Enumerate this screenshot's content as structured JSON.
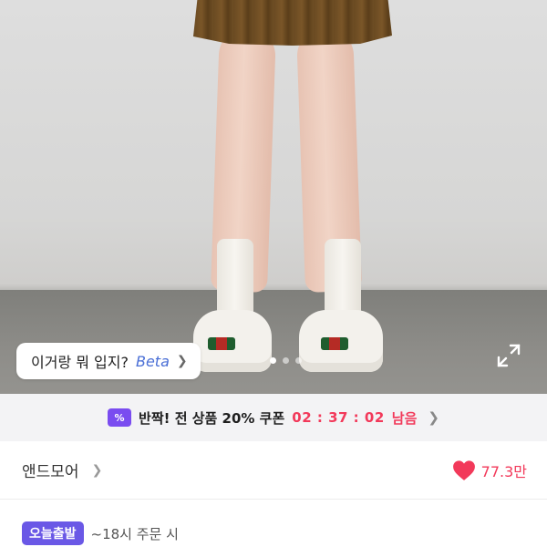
{
  "product_image": {
    "ai_chip": {
      "text": "이거랑 뭐 입지?",
      "beta": "Beta",
      "icon": "chevron-right-icon"
    },
    "carousel": {
      "count": 3,
      "active": 0
    },
    "expand_icon": "expand-icon"
  },
  "coupon_banner": {
    "icon": "coupon-icon",
    "icon_text": "%",
    "text": "반짝! 전 상품 20% 쿠폰",
    "timer": "02 : 37 : 02",
    "remaining": "남음"
  },
  "brand": {
    "name": "앤드모어",
    "likes": "77.3만"
  },
  "shipping": {
    "badge": "오늘출발",
    "text": "~18시 주문 시"
  },
  "colors": {
    "accent_red": "#f2395a",
    "coupon_purple": "#7a4cf0",
    "ship_badge": "#6a58e6",
    "beta_blue": "#4a6fd6"
  }
}
